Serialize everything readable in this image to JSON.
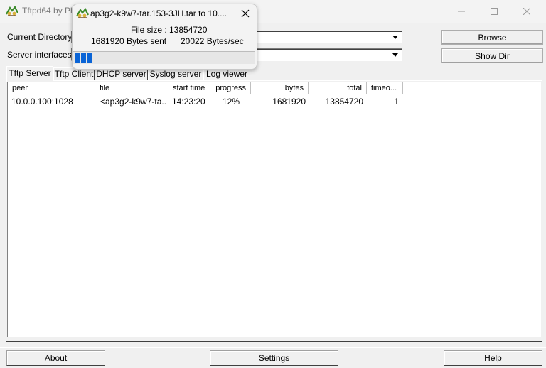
{
  "window": {
    "title": "Tftpd64 by Ph"
  },
  "labels": {
    "current_directory": "Current Directory",
    "server_interfaces": "Server interfaces"
  },
  "buttons": {
    "browse": "Browse",
    "show_dir": "Show Dir",
    "about": "About",
    "settings": "Settings",
    "help": "Help"
  },
  "tabs": [
    {
      "label": "Tftp Server",
      "active": true
    },
    {
      "label": "Tftp Client",
      "active": false
    },
    {
      "label": "DHCP server",
      "active": false
    },
    {
      "label": "Syslog server",
      "active": false
    },
    {
      "label": "Log viewer",
      "active": false
    }
  ],
  "table": {
    "columns": [
      "peer",
      "file",
      "start time",
      "progress",
      "bytes",
      "total",
      "timeo..."
    ],
    "rows": [
      [
        "10.0.0.100:1028",
        "<ap3g2-k9w7-ta...",
        "14:23:20",
        "12%",
        "1681920",
        "13854720",
        "1"
      ]
    ]
  },
  "transfer_popup": {
    "title": "ap3g2-k9w7-tar.153-3JH.tar to 10....",
    "file_size": "File size : 13854720",
    "bytes_sent": "1681920 Bytes sent",
    "rate": "20022 Bytes/sec",
    "progress_fraction": 0.12
  },
  "colors": {
    "progress": "#0a64d6",
    "background": "#f0f0f0"
  }
}
